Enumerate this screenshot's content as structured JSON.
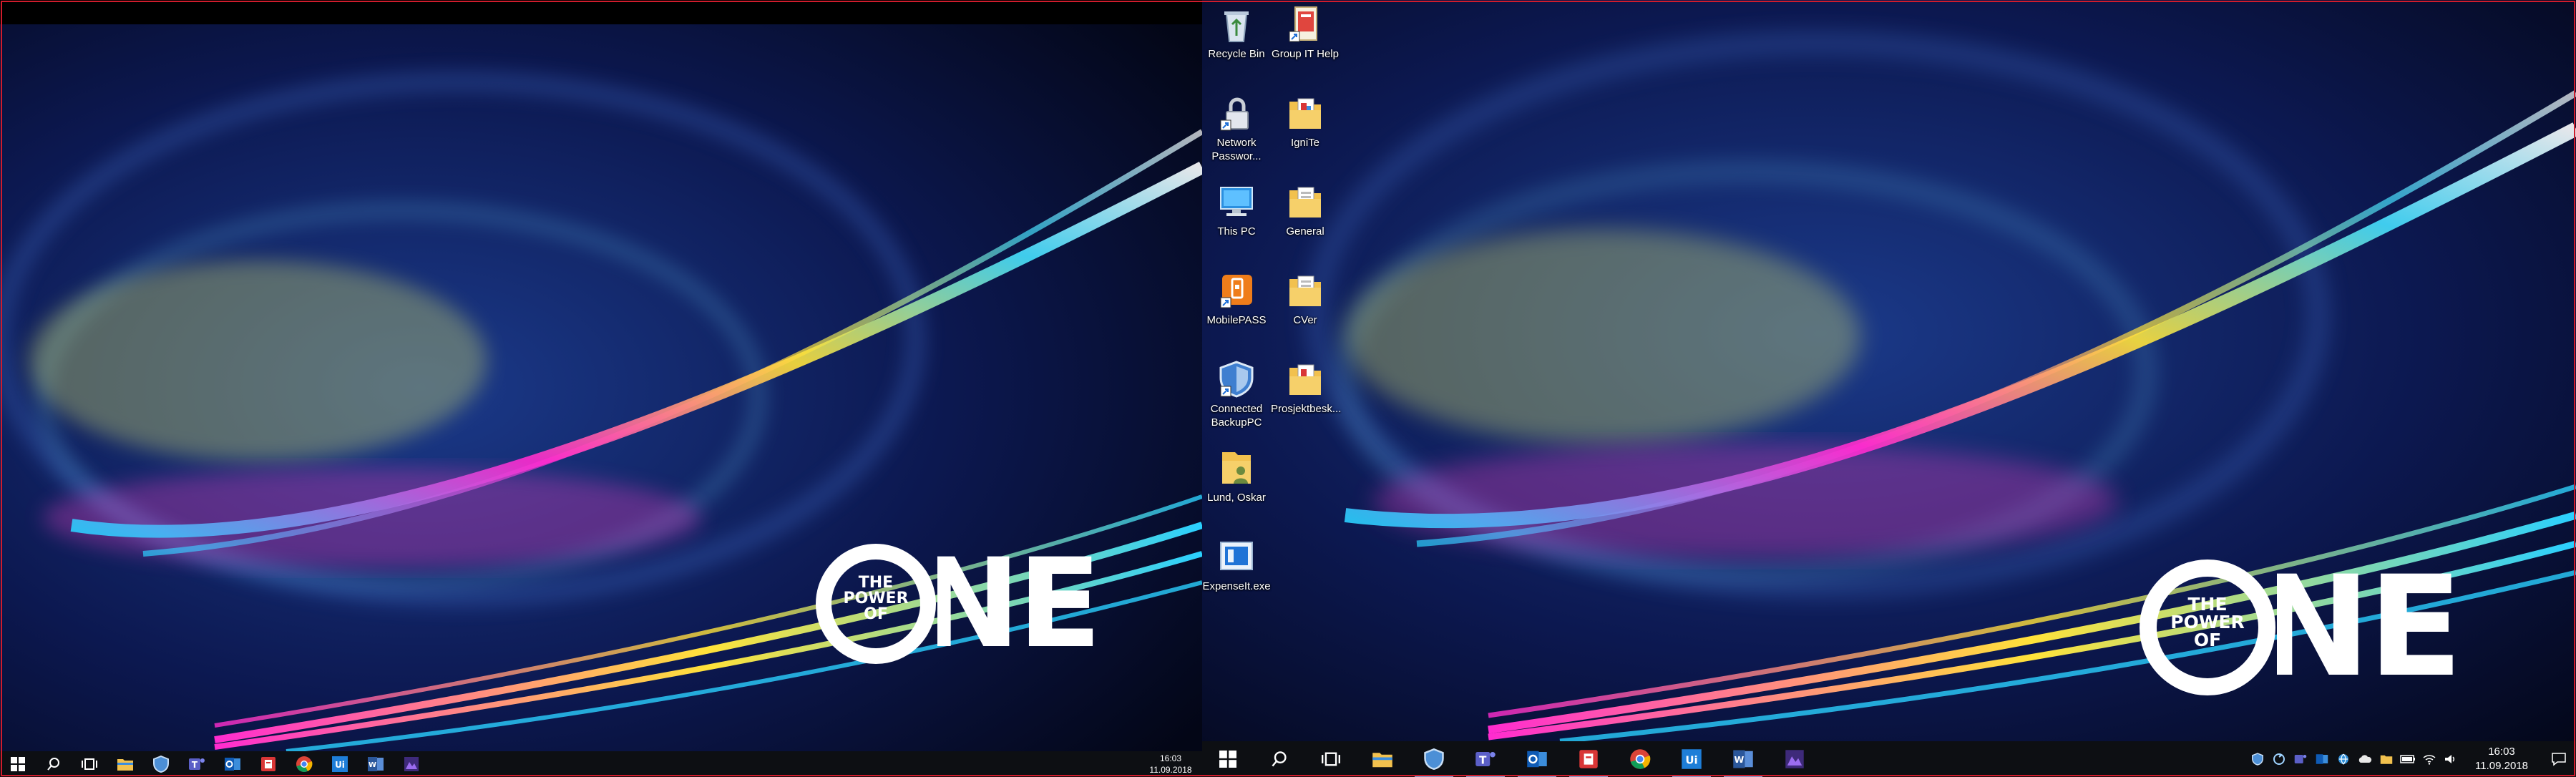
{
  "wallpaper": {
    "brand_word": "ONE",
    "brand_small_lines": [
      "THE",
      "POWER",
      "OF"
    ]
  },
  "desktop_icons": [
    {
      "id": "recycle-bin",
      "label": "Recycle Bin",
      "icon": "recycle-bin-icon"
    },
    {
      "id": "group-it-help",
      "label": "Group IT Help",
      "icon": "document-shortcut-icon"
    },
    {
      "id": "network-password",
      "label": "Network Passwor...",
      "icon": "lock-shortcut-icon"
    },
    {
      "id": "ignite",
      "label": "IgniTe",
      "icon": "folder-document-icon"
    },
    {
      "id": "this-pc",
      "label": "This PC",
      "icon": "computer-icon"
    },
    {
      "id": "general",
      "label": "General",
      "icon": "folder-document-icon"
    },
    {
      "id": "mobilepass",
      "label": "MobilePASS",
      "icon": "mobilepass-icon"
    },
    {
      "id": "cver",
      "label": "CVer",
      "icon": "folder-document-icon"
    },
    {
      "id": "connected-backuppc",
      "label": "Connected BackupPC",
      "icon": "shield-shortcut-icon"
    },
    {
      "id": "prosjektbesk",
      "label": "Prosjektbesk...",
      "icon": "folder-document-icon"
    },
    {
      "id": "lund-oskar",
      "label": "Lund, Oskar",
      "icon": "user-folder-icon"
    },
    {
      "id": "expenseit",
      "label": "ExpenseIt.exe",
      "icon": "expenseit-icon"
    }
  ],
  "taskbar_left": {
    "apps": [
      "start-icon",
      "search-icon",
      "task-view-icon",
      "file-explorer-icon",
      "shield-app-icon",
      "teams-icon",
      "outlook-icon",
      "red-app-icon",
      "chrome-icon",
      "uipath-icon",
      "word-icon",
      "purple-app-icon"
    ],
    "clock": {
      "time": "16:03",
      "date": "11.09.2018"
    }
  },
  "taskbar_right": {
    "apps": [
      "start-icon",
      "search-icon",
      "task-view-icon",
      "file-explorer-icon",
      "shield-app-icon",
      "teams-icon",
      "outlook-icon",
      "red-app-icon",
      "chrome-icon",
      "uipath-icon",
      "word-icon",
      "purple-app-icon"
    ],
    "active": [
      "shield-app-icon",
      "teams-icon",
      "outlook-icon",
      "red-app-icon",
      "uipath-icon",
      "word-icon"
    ],
    "tray": [
      "shield-tray-icon",
      "sync-tray-icon",
      "teams-tray-icon",
      "outlook-tray-icon",
      "globe-tray-icon",
      "onedrive-tray-icon",
      "folder-tray-icon",
      "battery-tray-icon",
      "wifi-tray-icon",
      "volume-tray-icon"
    ],
    "clock": {
      "time": "16:03",
      "date": "11.09.2018"
    }
  },
  "colors": {
    "taskbar": "#0d0f13",
    "frame": "#d01c2c",
    "active_indicator": "#7aa7d9",
    "wall_dark": "#04081e"
  }
}
